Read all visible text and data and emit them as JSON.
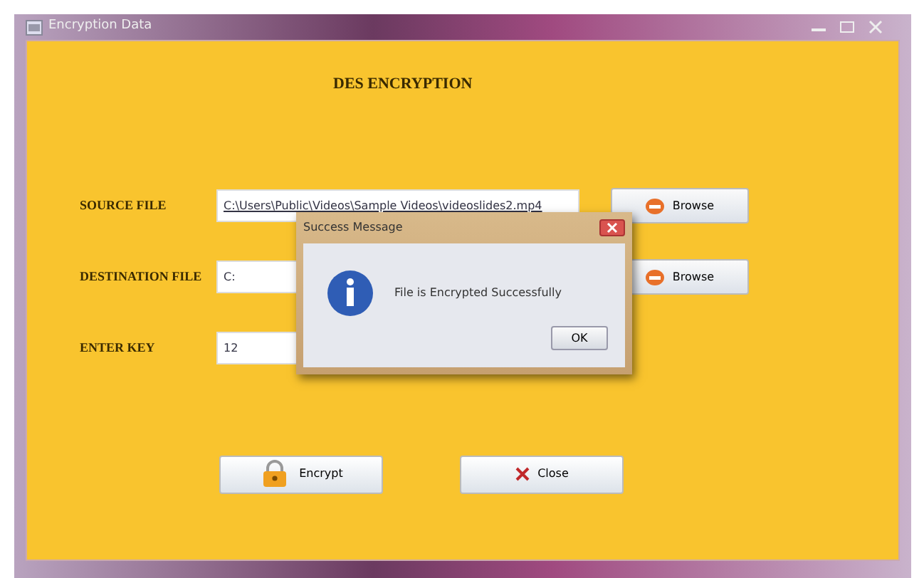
{
  "window": {
    "title": "Encryption Data"
  },
  "heading": "DES ENCRYPTION",
  "rows": [
    {
      "label": "SOURCE FILE",
      "value": "C:\\Users\\Public\\Videos\\Sample Videos\\videoslides2.mp4",
      "button": "Browse"
    },
    {
      "label": "DESTINATION FILE",
      "value": "C:",
      "button": "Browse"
    },
    {
      "label": "ENTER KEY",
      "value": "12"
    }
  ],
  "actions": [
    {
      "kind": "encrypt",
      "label": "Encrypt"
    },
    {
      "kind": "close",
      "label": "Close"
    }
  ],
  "dialog": {
    "title": "Success Message",
    "message": "File is Encrypted Successfully",
    "button": "OK"
  }
}
